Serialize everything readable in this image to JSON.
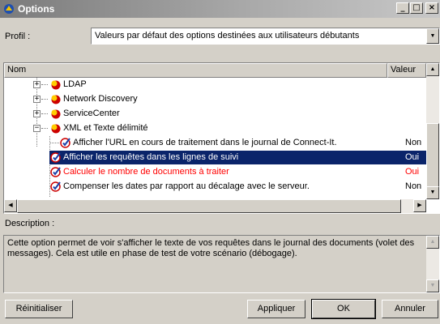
{
  "window": {
    "title": "Options",
    "minimize": "_",
    "maximize": "□",
    "close": "×"
  },
  "profil": {
    "label": "Profil :",
    "value": "Valeurs par défaut des options destinées aux utilisateurs débutants"
  },
  "columns": {
    "name": "Nom",
    "value": "Valeur"
  },
  "tree": [
    {
      "label": "LDAP",
      "value": ""
    },
    {
      "label": "Network Discovery",
      "value": ""
    },
    {
      "label": "ServiceCenter",
      "value": ""
    },
    {
      "label": "XML et Texte délimité",
      "value": ""
    },
    {
      "label": "Afficher l'URL en cours de traitement dans le journal de Connect-It.",
      "value": "Non"
    },
    {
      "label": "Afficher les requêtes dans les lignes de suivi",
      "value": "Oui"
    },
    {
      "label": "Calculer le nombre de documents à traiter",
      "value": "Oui"
    },
    {
      "label": "Compenser les dates par rapport au décalage avec le serveur.",
      "value": "Non"
    }
  ],
  "description": {
    "label": "Description :",
    "text": "Cette option permet de voir s'afficher le texte de vos requêtes dans le journal des documents (volet des messages). Cela est utile en phase de test de votre scénario (débogage)."
  },
  "buttons": {
    "reset": "Réinitialiser",
    "apply": "Appliquer",
    "ok": "OK",
    "cancel": "Annuler"
  },
  "colors": {
    "selection": "#0a246a",
    "modified_text": "#ff0000",
    "title_gradient_start": "#7b7b7b"
  }
}
